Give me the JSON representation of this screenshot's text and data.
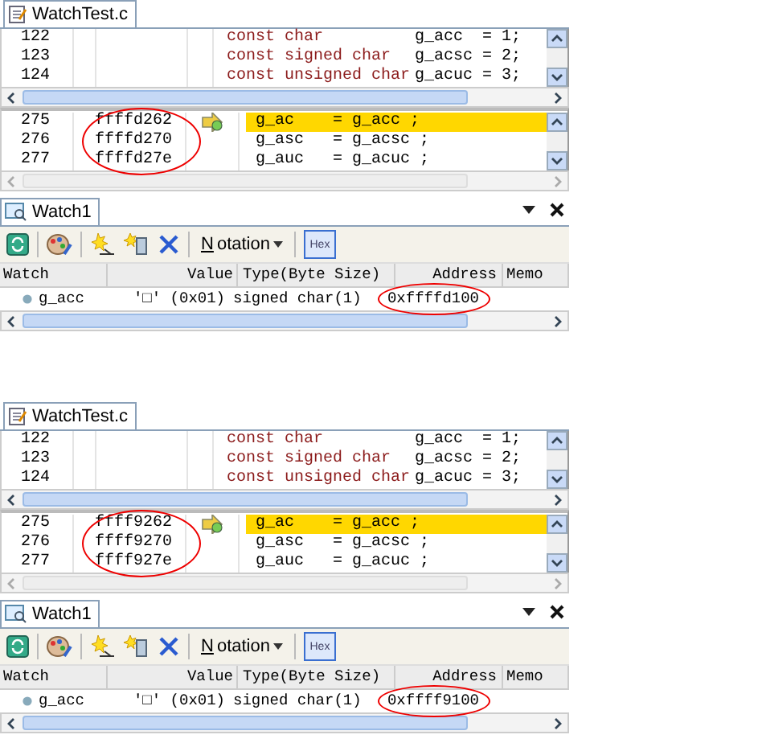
{
  "panels": [
    {
      "editor_tab": "WatchTest.c",
      "top_lines": [
        {
          "number": "122",
          "type": "const char",
          "decl": "g_acc  = 1;"
        },
        {
          "number": "123",
          "type": "const signed char",
          "decl": "g_acsc = 2;"
        },
        {
          "number": "124",
          "type": "const unsigned char",
          "decl": "g_acuc = 3;"
        }
      ],
      "bottom_lines": [
        {
          "number": "275",
          "address": "ffffd262",
          "code": "g_ac    = g_acc ;",
          "current": true
        },
        {
          "number": "276",
          "address": "ffffd270",
          "code": "g_asc   = g_acsc ;",
          "current": false
        },
        {
          "number": "277",
          "address": "ffffd27e",
          "code": "g_auc   = g_acuc ;",
          "current": false
        }
      ],
      "watch": {
        "tab": "Watch1",
        "notation": "Notation",
        "hex": {
          "label": "Hex",
          "pressed": true
        },
        "columns": [
          "Watch",
          "Value",
          "Type(Byte Size)",
          "Address",
          "Memo"
        ],
        "rows": [
          {
            "name": "g_acc",
            "value": "'□' (0x01)",
            "type": "signed char(1)",
            "address": "0xffffd100"
          }
        ]
      }
    },
    {
      "editor_tab": "WatchTest.c",
      "top_lines": [
        {
          "number": "122",
          "type": "const char",
          "decl": "g_acc  = 1;"
        },
        {
          "number": "123",
          "type": "const signed char",
          "decl": "g_acsc = 2;"
        },
        {
          "number": "124",
          "type": "const unsigned char",
          "decl": "g_acuc = 3;"
        }
      ],
      "bottom_lines": [
        {
          "number": "275",
          "address": "ffff9262",
          "code": "g_ac    = g_acc ;",
          "current": true
        },
        {
          "number": "276",
          "address": "ffff9270",
          "code": "g_asc   = g_acsc ;",
          "current": false
        },
        {
          "number": "277",
          "address": "ffff927e",
          "code": "g_auc   = g_acuc ;",
          "current": false
        }
      ],
      "watch": {
        "tab": "Watch1",
        "notation": "Notation",
        "hex": {
          "label": "Hex",
          "pressed": true
        },
        "columns": [
          "Watch",
          "Value",
          "Type(Byte Size)",
          "Address",
          "Memo"
        ],
        "rows": [
          {
            "name": "g_acc",
            "value": "'□' (0x01)",
            "type": "signed char(1)",
            "address": "0xffff9100"
          }
        ]
      }
    }
  ]
}
